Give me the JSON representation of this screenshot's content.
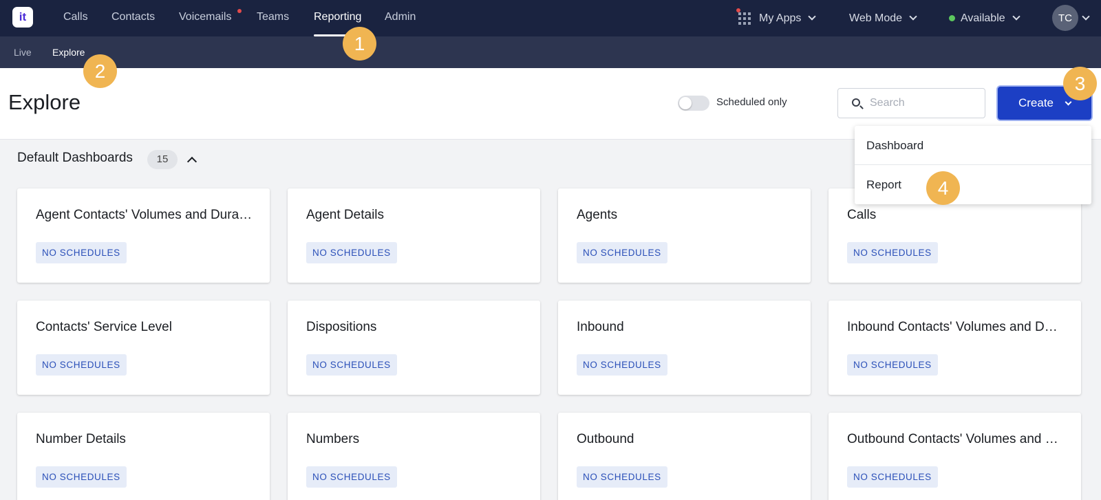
{
  "app": {
    "logo_text": "it"
  },
  "topnav": {
    "items": [
      {
        "label": "Calls"
      },
      {
        "label": "Contacts"
      },
      {
        "label": "Voicemails"
      },
      {
        "label": "Teams"
      },
      {
        "label": "Reporting"
      },
      {
        "label": "Admin"
      }
    ],
    "my_apps": "My Apps",
    "web_mode": "Web Mode",
    "status": "Available",
    "avatar_initials": "TC"
  },
  "subnav": {
    "items": [
      {
        "label": "Live"
      },
      {
        "label": "Explore"
      }
    ]
  },
  "header": {
    "title": "Explore",
    "toggle_label": "Scheduled only",
    "search_placeholder": "Search",
    "create_label": "Create"
  },
  "dropdown": {
    "items": [
      {
        "label": "Dashboard"
      },
      {
        "label": "Report"
      }
    ]
  },
  "section": {
    "title": "Default Dashboards",
    "count": "15"
  },
  "cards": [
    {
      "title": "Agent Contacts' Volumes and Durations",
      "badge": "NO SCHEDULES"
    },
    {
      "title": "Agent Details",
      "badge": "NO SCHEDULES"
    },
    {
      "title": "Agents",
      "badge": "NO SCHEDULES"
    },
    {
      "title": "Calls",
      "badge": "NO SCHEDULES"
    },
    {
      "title": "Contacts' Service Level",
      "badge": "NO SCHEDULES"
    },
    {
      "title": "Dispositions",
      "badge": "NO SCHEDULES"
    },
    {
      "title": "Inbound",
      "badge": "NO SCHEDULES"
    },
    {
      "title": "Inbound Contacts' Volumes and Durations",
      "badge": "NO SCHEDULES"
    },
    {
      "title": "Number Details",
      "badge": "NO SCHEDULES"
    },
    {
      "title": "Numbers",
      "badge": "NO SCHEDULES"
    },
    {
      "title": "Outbound",
      "badge": "NO SCHEDULES"
    },
    {
      "title": "Outbound Contacts' Volumes and Durations",
      "badge": "NO SCHEDULES"
    }
  ],
  "callouts": [
    "1",
    "2",
    "3",
    "4"
  ],
  "colors": {
    "nav_bg": "#1a2340",
    "subnav_bg": "#2d3550",
    "primary": "#1c3fc4",
    "callout": "#f0b552",
    "badge_text": "#2a4fb8"
  }
}
